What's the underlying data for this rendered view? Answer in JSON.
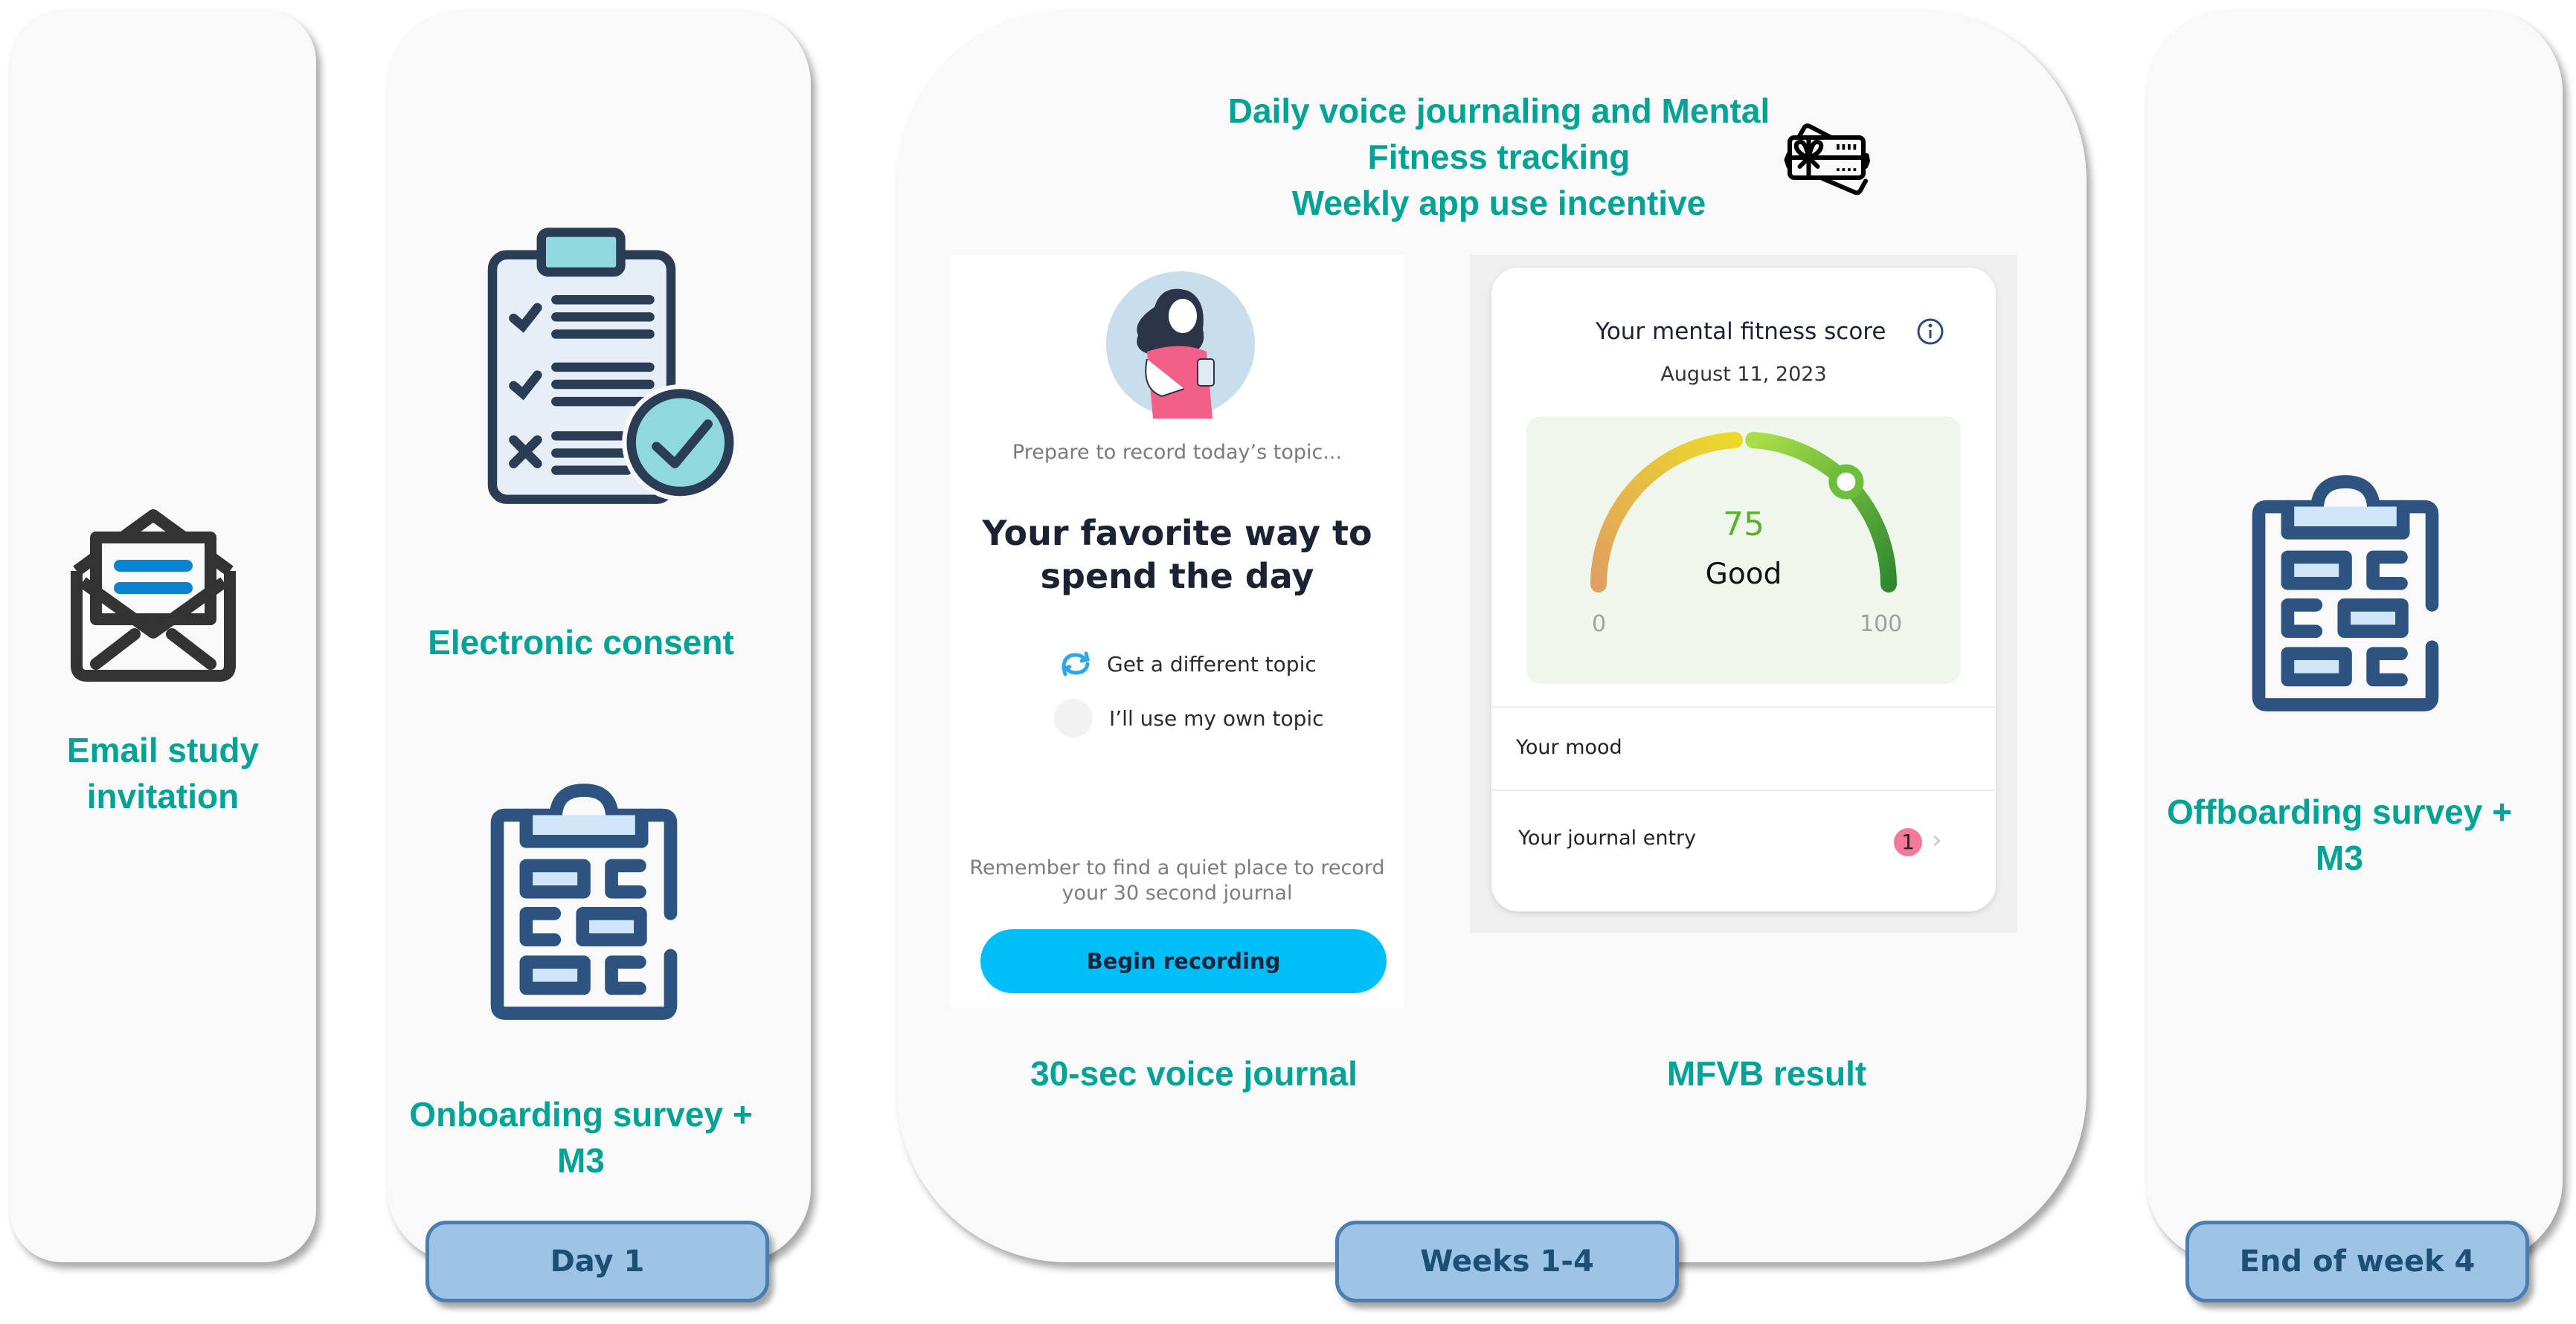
{
  "stages": [
    {
      "label": "Email study invitation",
      "icon": "envelope-icon"
    },
    {
      "label": "Day 1",
      "items": [
        "Electronic consent",
        "Onboarding survey + M3"
      ],
      "icons": [
        "consent-clipboard-icon",
        "survey-clipboard-icon"
      ]
    },
    {
      "label": "Weeks 1-4",
      "header_lines": [
        "Daily voice journaling and Mental",
        "Fitness tracking",
        "Weekly app use incentive"
      ],
      "icon": "gift-card-icon",
      "captions": [
        "30-sec voice journal",
        "MFVB result"
      ]
    },
    {
      "label": "End of week 4",
      "items": [
        "Offboarding survey + M3"
      ],
      "icon": "survey-clipboard-icon"
    }
  ],
  "email": {
    "line1": "Email study",
    "line2": "invitation"
  },
  "day1": {
    "consent": "Electronic consent",
    "survey_line1": "Onboarding survey +",
    "survey_line2": "M3",
    "pill": "Day 1"
  },
  "weeks": {
    "header1": "Daily voice journaling and Mental",
    "header2": "Fitness tracking",
    "header3": "Weekly app use incentive",
    "caption_journal": "30-sec voice journal",
    "caption_result": "MFVB result",
    "pill": "Weeks 1-4"
  },
  "end": {
    "survey_line1": "Offboarding survey +",
    "survey_line2": "M3",
    "pill": "End of week 4"
  },
  "journal_screen": {
    "prepare": "Prepare to record today’s topic...",
    "topic_line1": "Your favorite way to",
    "topic_line2": "spend the day",
    "option_different": "Get a different topic",
    "option_own": "I’ll use my own topic",
    "reminder_line1": "Remember to find a quiet place to record",
    "reminder_line2": "your 30 second journal",
    "begin_button": "Begin recording"
  },
  "result_screen": {
    "title": "Your mental fitness score",
    "date": "August 11, 2023",
    "score": "75",
    "score_value": 75,
    "rating": "Good",
    "min": "0",
    "max": "100",
    "mood_label": "Your mood",
    "journal_label": "Your journal entry",
    "journal_count": "1"
  },
  "colors": {
    "accent_teal": "#00a396",
    "pill_fill": "#9dc3e6",
    "pill_border": "#4a7db0",
    "button_blue": "#00bff8",
    "badge_pink": "#f7789a"
  }
}
